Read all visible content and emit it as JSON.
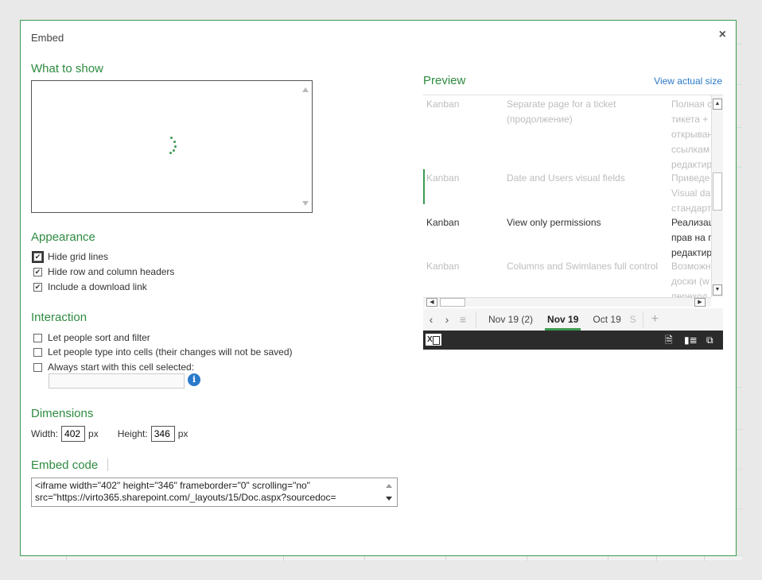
{
  "dialog": {
    "title": "Embed",
    "close_label": "×"
  },
  "what_to_show": {
    "heading": "What to show"
  },
  "appearance": {
    "heading": "Appearance",
    "options": [
      {
        "label": "Hide grid lines",
        "checked": true
      },
      {
        "label": "Hide row and column headers",
        "checked": true
      },
      {
        "label": "Include a download link",
        "checked": true
      }
    ]
  },
  "interaction": {
    "heading": "Interaction",
    "options": [
      {
        "label": "Let people sort and filter",
        "checked": false
      },
      {
        "label": "Let people type into cells (their changes will not be saved)",
        "checked": false
      },
      {
        "label": "Always start with this cell selected:",
        "checked": false
      }
    ],
    "cell_value": ""
  },
  "dimensions": {
    "heading": "Dimensions",
    "width_label": "Width:",
    "width_value": "402",
    "width_unit": "px",
    "height_label": "Height:",
    "height_value": "346",
    "height_unit": "px"
  },
  "embed_code": {
    "heading": "Embed code",
    "line1": "<iframe width=\"402\" height=\"346\" frameborder=\"0\" scrolling=\"no\"",
    "line2": "src=\"https://virto365.sharepoint.com/_layouts/15/Doc.aspx?sourcedoc="
  },
  "preview": {
    "heading": "Preview",
    "view_actual_size": "View actual size",
    "rows": [
      {
        "c1": "Kanban",
        "c2": [
          "Separate page for a ticket",
          "(продолжение)"
        ],
        "c3": [
          "Полная с",
          "тикета +",
          "открыван",
          "ссылкам",
          "редактир"
        ],
        "dim": true
      },
      {
        "c1": "Kanban",
        "c2": [
          "Date and Users visual fields"
        ],
        "c3": [
          "Приведе",
          "Visual da",
          "стандарт"
        ],
        "dim": true
      },
      {
        "c1": "Kanban",
        "c2": [
          "View only permissions"
        ],
        "c3": [
          "Реализац",
          "прав на п",
          "редактир"
        ],
        "dim": false
      },
      {
        "c1": "Kanban",
        "c2": [
          "Columns and Swimlanes full control"
        ],
        "c3": [
          "Возможн",
          "доски (w",
          "переход"
        ],
        "dim": true
      }
    ],
    "tabs": [
      "Nov 19 (2)",
      "Nov 19",
      "Oct 19",
      "S"
    ],
    "active_tab": "Nov 19",
    "nav": {
      "prev": "‹",
      "next": "›",
      "all": "≡",
      "add": "+"
    },
    "excel_logo": "X"
  }
}
